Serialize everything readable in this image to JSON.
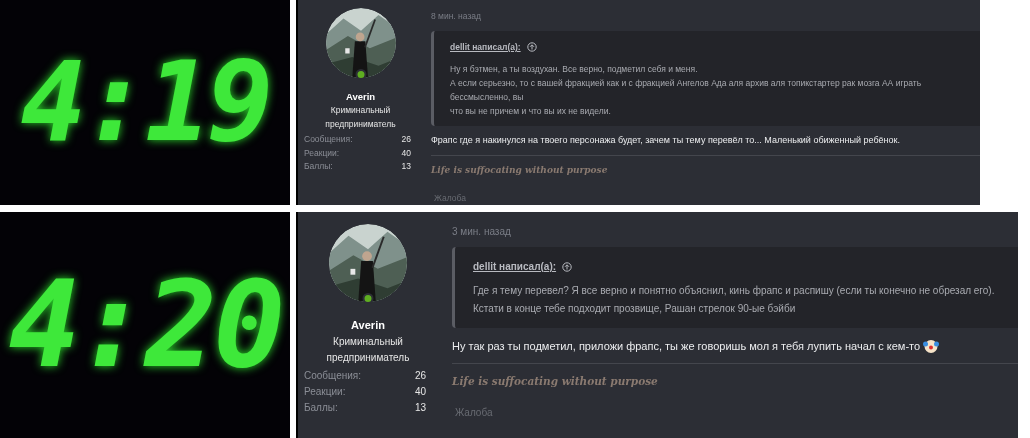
{
  "panels": [
    {
      "clock": {
        "time": "4:19"
      },
      "post": {
        "time_ago": "8 мин. назад",
        "author": "Averin",
        "user_title": "Криминальный предприниматель",
        "stats": [
          {
            "label": "Сообщения:",
            "value": "26"
          },
          {
            "label": "Реакции:",
            "value": "40"
          },
          {
            "label": "Баллы:",
            "value": "13"
          }
        ],
        "quote": {
          "author": "dellit написал(а):",
          "lines": [
            "Ну я бэтмен, а ты воздухан. Все верно, подметил себя и меня.",
            "А если серьезно, то с вашей фракцией как и с фракцией Ангелов Ада аля архив аля топикстартер рак мозга АА играть бессмысленно, вы",
            "что вы не причем и что вы их не видели."
          ]
        },
        "message": "Фрапс где я накинулся на твоего персонажа будет, зачем ты тему перевёл то... Маленький обиженный ребёнок.",
        "signature": "Life is suffocating without purpose",
        "report": "Жалоба"
      }
    },
    {
      "clock": {
        "time": "4:20"
      },
      "post": {
        "time_ago": "3 мин. назад",
        "author": "Averin",
        "user_title": "Криминальный предприниматель",
        "stats": [
          {
            "label": "Сообщения:",
            "value": "26"
          },
          {
            "label": "Реакции:",
            "value": "40"
          },
          {
            "label": "Баллы:",
            "value": "13"
          }
        ],
        "quote": {
          "author": "dellit написал(а):",
          "lines": [
            "Где я тему перевел? Я все верно и понятно объяснил, кинь фрапс и распишу (если ты конечно не обрезал его).",
            "Кстати в конце тебе подходит прозвище, Рашан стрелок 90-ые бэйби"
          ]
        },
        "message": "Ну так раз ты подметил, приложи фрапс, ты же говоришь мол я тебя лупить начал с кем-то",
        "signature": "Life is suffocating without purpose",
        "report": "Жалоба"
      }
    }
  ]
}
